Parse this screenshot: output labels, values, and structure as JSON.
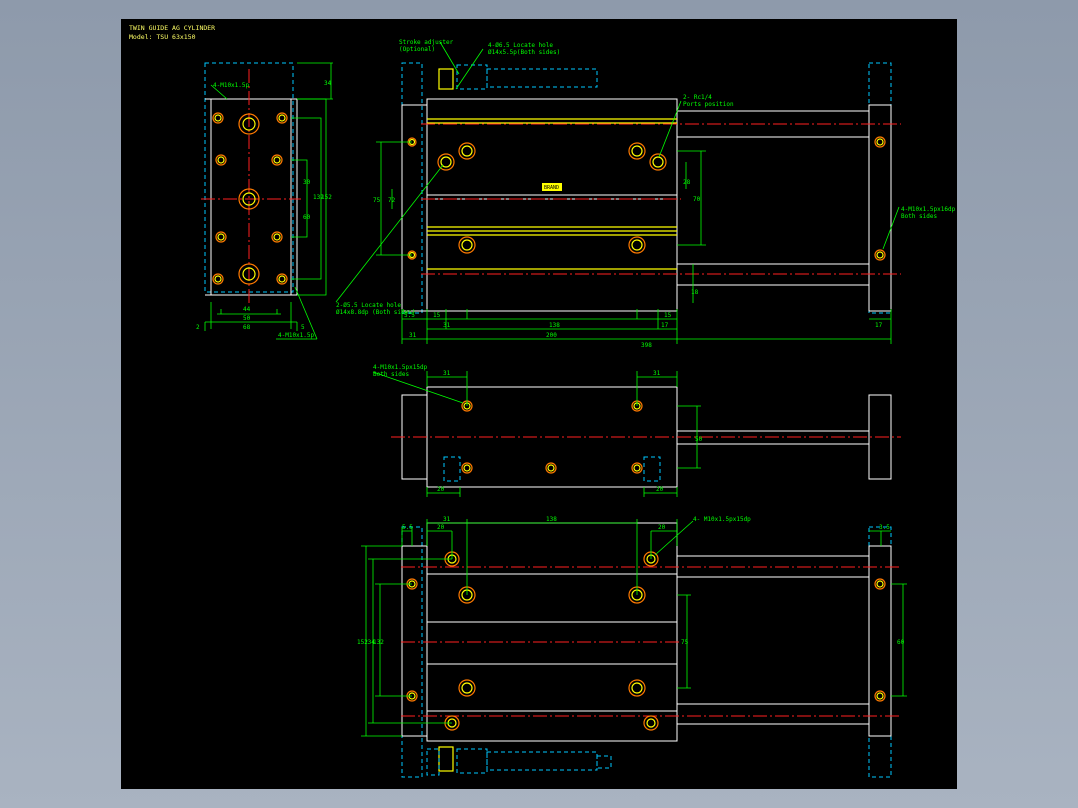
{
  "title": {
    "line1": "TWIN GUIDE AG CYLINDER",
    "line2": "Model: TSU 63x150"
  },
  "labels": {
    "side_tap": "4-M10x1.5p",
    "bottom_tap": "4-M10x1.5p",
    "stroke_adjust_1": "Stroke adjuster",
    "stroke_adjust_2": "(Optional)",
    "lock_nut_1": "4-Ø6.5 Locate hole",
    "lock_nut_2": "Ø14x5.5p(Both sides)",
    "port_1": "2- Rc1/4",
    "port_2": "Ports position",
    "right_tap_1": "4-M10x1.5px16dp",
    "right_tap_2": "Both sides",
    "cbore_1": "2-Ø5.5 Locate hole",
    "cbore_2": "Ø14x8.8dp (Both sides)",
    "top_tap_1": "4-M10x1.5px15dp",
    "top_tap_2": "Both sides",
    "bot_tap": "4- M10x1.5px15dp",
    "logo": "BRAND"
  },
  "dims": {
    "d34": "34",
    "d44": "44",
    "d50": "50",
    "d68": "68",
    "d2": "2",
    "d5": "5",
    "d30": "30",
    "d152": "152",
    "d132": "132",
    "d60": "60",
    "d75": "75",
    "d31": "31",
    "d17": "17",
    "d200": "200",
    "d398": "398",
    "d138": "138",
    "d15": "15",
    "d28": "28",
    "d72": "72",
    "d18": "18",
    "d33": "33",
    "d20": "20",
    "d70": "70",
    "d35": "3.5",
    "d55": "5.5",
    "d134": "134"
  }
}
